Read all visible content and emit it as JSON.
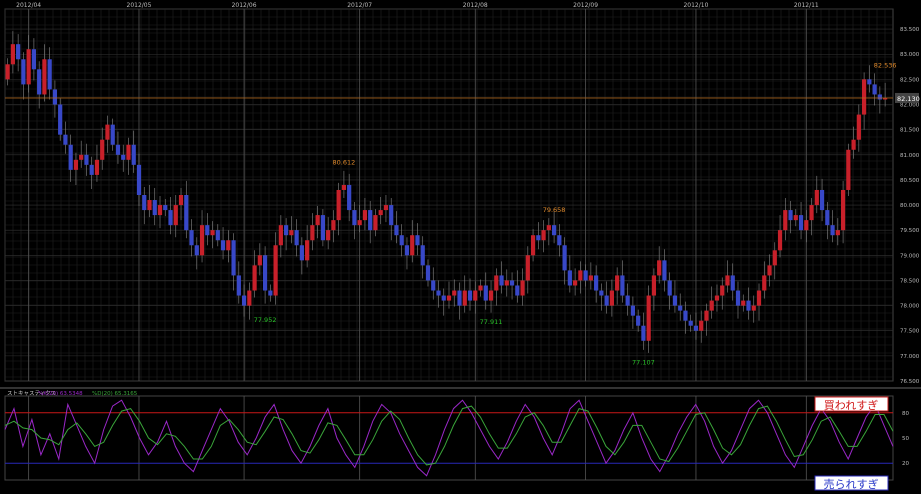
{
  "chart_data": [
    {
      "type": "candlestick",
      "x_ticks": [
        "2012/04",
        "2012/05",
        "2012/06",
        "2012/07",
        "2012/08",
        "2012/09",
        "2012/10",
        "2012/11"
      ],
      "x_tick_index": [
        4,
        25,
        45,
        67,
        89,
        110,
        131,
        152
      ],
      "y_ticks": [
        76.5,
        77.0,
        77.5,
        78.0,
        78.5,
        79.0,
        79.5,
        80.0,
        80.5,
        81.0,
        81.5,
        82.0,
        82.5,
        83.0,
        83.5
      ],
      "y_tick_labels": [
        "76.500",
        "77.000",
        "77.500",
        "78.000",
        "78.500",
        "79.000",
        "79.500",
        "80.000",
        "80.500",
        "81.000",
        "81.500",
        "82.000",
        "82.500",
        "83.000",
        "83.500"
      ],
      "ylim": [
        76.5,
        83.9
      ],
      "current_price": 82.13,
      "current_price_label": "82.130",
      "annotations": [
        {
          "index": 167,
          "price": 82.536,
          "text": "82.536",
          "kind": "high"
        },
        {
          "index": 64,
          "price": 80.612,
          "text": "80.612",
          "kind": "high"
        },
        {
          "index": 104,
          "price": 79.658,
          "text": "79.658",
          "kind": "high"
        },
        {
          "index": 49,
          "price": 77.952,
          "text": "77.952",
          "kind": "low"
        },
        {
          "index": 92,
          "price": 77.911,
          "text": "77.911",
          "kind": "low"
        },
        {
          "index": 121,
          "price": 77.107,
          "text": "77.107",
          "kind": "low"
        }
      ],
      "closes": [
        82.8,
        83.2,
        82.9,
        82.4,
        83.1,
        82.7,
        82.2,
        82.9,
        82.3,
        82.0,
        81.4,
        81.2,
        80.7,
        80.9,
        81.0,
        80.8,
        80.6,
        80.9,
        81.3,
        81.6,
        81.2,
        81.0,
        80.9,
        81.2,
        80.8,
        80.2,
        79.9,
        80.1,
        79.8,
        80.0,
        79.9,
        79.6,
        80.0,
        80.2,
        79.5,
        79.2,
        79.0,
        79.6,
        79.4,
        79.5,
        79.3,
        79.1,
        79.3,
        78.6,
        78.2,
        78.0,
        78.3,
        78.8,
        79.0,
        78.3,
        78.2,
        79.2,
        79.6,
        79.4,
        79.5,
        79.2,
        78.9,
        79.3,
        79.6,
        79.8,
        79.3,
        79.5,
        79.7,
        80.3,
        80.4,
        79.9,
        79.6,
        79.7,
        79.9,
        79.5,
        79.8,
        79.9,
        80.0,
        79.6,
        79.4,
        79.2,
        79.0,
        79.4,
        79.2,
        78.8,
        78.5,
        78.3,
        78.2,
        78.1,
        78.2,
        78.3,
        78.0,
        78.3,
        78.1,
        78.3,
        78.4,
        78.1,
        78.3,
        78.6,
        78.4,
        78.5,
        78.4,
        78.2,
        78.5,
        79.0,
        79.4,
        79.3,
        79.5,
        79.6,
        79.4,
        79.2,
        78.7,
        78.4,
        78.5,
        78.7,
        78.5,
        78.6,
        78.3,
        78.2,
        78.0,
        78.3,
        78.6,
        78.2,
        78.0,
        77.8,
        77.6,
        77.3,
        78.2,
        78.6,
        78.9,
        78.5,
        78.2,
        78.0,
        77.9,
        77.7,
        77.6,
        77.5,
        77.7,
        77.9,
        78.1,
        78.2,
        78.4,
        78.6,
        78.3,
        78.0,
        78.1,
        77.9,
        78.0,
        78.3,
        78.6,
        78.8,
        79.1,
        79.5,
        79.9,
        79.7,
        79.8,
        79.5,
        79.7,
        80.0,
        80.3,
        79.9,
        79.6,
        79.4,
        79.5,
        80.3,
        81.1,
        81.3,
        81.8,
        82.5,
        82.4,
        82.2,
        82.1,
        82.13
      ]
    },
    {
      "type": "line",
      "title": "ストキャスティクス",
      "k_label": "%K(20) 63.5348",
      "d_label": "%D(20) 65.3165",
      "y_ticks": [
        20,
        50,
        80
      ],
      "ylim": [
        0,
        100
      ],
      "overbought": 80,
      "oversold": 20,
      "overbought_text": "買われすぎ",
      "oversold_text": "売られすぎ",
      "k": [
        60,
        85,
        40,
        72,
        30,
        55,
        25,
        90,
        65,
        40,
        20,
        60,
        88,
        95,
        75,
        50,
        30,
        45,
        70,
        40,
        20,
        10,
        35,
        60,
        85,
        70,
        45,
        30,
        50,
        75,
        90,
        60,
        35,
        20,
        40,
        65,
        85,
        50,
        30,
        15,
        40,
        70,
        90,
        80,
        55,
        35,
        15,
        5,
        30,
        60,
        85,
        95,
        80,
        60,
        40,
        25,
        45,
        70,
        90,
        75,
        50,
        30,
        55,
        85,
        95,
        70,
        45,
        20,
        35,
        60,
        80,
        50,
        25,
        10,
        30,
        55,
        75,
        90,
        70,
        40,
        20,
        35,
        60,
        85,
        95,
        80,
        55,
        30,
        15,
        40,
        65,
        85,
        70,
        45,
        25,
        50,
        75,
        90,
        65,
        40
      ],
      "d": [
        65,
        70,
        62,
        60,
        50,
        48,
        42,
        60,
        68,
        55,
        40,
        45,
        65,
        82,
        85,
        70,
        50,
        42,
        55,
        52,
        40,
        25,
        25,
        40,
        65,
        72,
        60,
        45,
        42,
        58,
        75,
        72,
        55,
        35,
        32,
        48,
        68,
        65,
        48,
        30,
        30,
        48,
        70,
        82,
        72,
        50,
        30,
        18,
        20,
        40,
        65,
        85,
        88,
        75,
        55,
        38,
        38,
        55,
        75,
        80,
        65,
        45,
        45,
        65,
        85,
        82,
        62,
        40,
        30,
        45,
        65,
        65,
        45,
        25,
        22,
        38,
        58,
        78,
        80,
        60,
        38,
        30,
        42,
        65,
        85,
        88,
        70,
        48,
        28,
        30,
        48,
        70,
        75,
        58,
        40,
        40,
        58,
        78,
        78,
        58
      ]
    }
  ],
  "colors": {
    "up": "#c8202a",
    "down": "#3848c8",
    "wick": "#8a8a8a",
    "grid": "#262626",
    "month_line": "#555555",
    "price_line": "#b86a1a",
    "axis_text": "#bbbbbb",
    "high_label": "#e08a2c",
    "low_label": "#28c028",
    "k_line": "#9a28c8",
    "d_line": "#3aa53a",
    "overbought_line": "#c81818",
    "oversold_line": "#2828b8"
  }
}
